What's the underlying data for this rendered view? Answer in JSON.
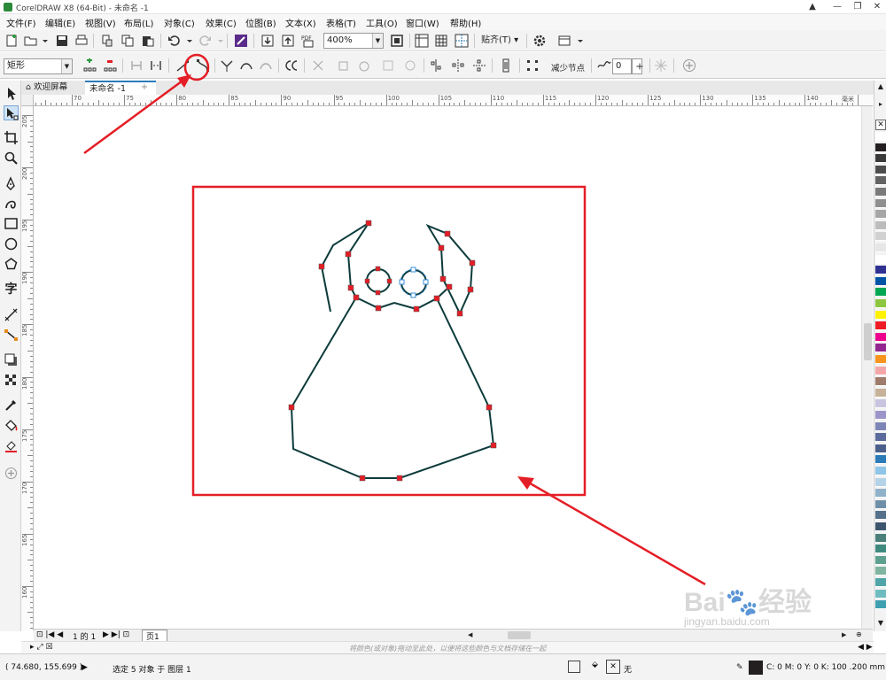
{
  "app": {
    "title": "CorelDRAW X8 (64-Bit) - 未命名 -1",
    "window_buttons": [
      "▲",
      "—",
      "❐",
      "✕"
    ]
  },
  "menu": [
    "文件(F)",
    "编辑(E)",
    "视图(V)",
    "布局(L)",
    "对象(C)",
    "效果(C)",
    "位图(B)",
    "文本(X)",
    "表格(T)",
    "工具(O)",
    "窗口(W)",
    "帮助(H)"
  ],
  "standard_toolbar": {
    "zoom": "400%",
    "snap_label": "贴齐(T)"
  },
  "property_bar": {
    "object_type": "矩形",
    "reduce_nodes": "减少节点",
    "curve_smoothness": "0"
  },
  "doc_tabs": {
    "welcome": "欢迎屏幕",
    "document": "未命名 -1",
    "add": "+"
  },
  "ruler": {
    "h_labels": [
      "70",
      "75",
      "80",
      "85",
      "90",
      "95",
      "100",
      "105",
      "110",
      "115",
      "120",
      "125",
      "130",
      "135",
      "140"
    ],
    "h_unit": "毫米",
    "v_labels": [
      "205",
      "200",
      "195",
      "190",
      "185",
      "180",
      "175",
      "170",
      "165",
      "160"
    ]
  },
  "page_nav": {
    "counter": "1 的 1",
    "page_tab": "页1"
  },
  "color_hint": "将颜色(或对象)拖动至此处，以便将这些颜色与文档存储在一起",
  "status": {
    "coords": "( 74.680, 155.699 )",
    "selection": "选定 5 对象 于 图层 1",
    "fill_none": "无",
    "outline_info": "C: 0 M: 0 Y: 0 K: 100  .200 mm"
  },
  "palette_colors": [
    "#ffffff",
    "#231f20",
    "#3a3a3a",
    "#4d4d4d",
    "#636363",
    "#7a7a7a",
    "#8f8f8f",
    "#a6a6a6",
    "#bcbcbc",
    "#d1d1d1",
    "#e6e6e6",
    "#ffffff",
    "#2e3192",
    "#0054a6",
    "#00a651",
    "#8dc63f",
    "#fff200",
    "#ed1c24",
    "#ec008c",
    "#92278f",
    "#f7941d",
    "#f4a7a8",
    "#9e7b6a",
    "#c7b299",
    "#c9c4e0",
    "#9b95c9",
    "#7d86b6",
    "#5a6b9c",
    "#4a5f8a",
    "#2b7bb9",
    "#8ec5e8",
    "#b5d3e7",
    "#8fb1c9",
    "#6f8fa8",
    "#55708a",
    "#3d566e",
    "#4a7f7a",
    "#3f8a80",
    "#5ea08f",
    "#7fb5a1",
    "#4fa5a8",
    "#6fbcc0",
    "#3e9fb0"
  ],
  "watermark": {
    "brand": "Bai",
    "brand_suffix": "经验",
    "url": "jingyan.baidu.com"
  },
  "annotation_color": "#e41e26"
}
